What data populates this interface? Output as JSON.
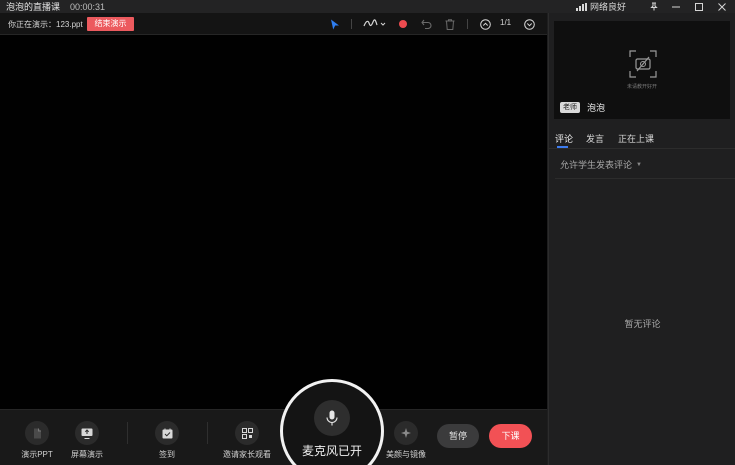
{
  "window": {
    "title": "泡泡的直播课",
    "timer": "00:00:31",
    "network_label": "网络良好"
  },
  "presentation": {
    "status_text": "你正在演示：123.ppt",
    "end_label": "结束演示",
    "page_indicator": "1/1",
    "tools": [
      "pointer-icon",
      "pen-icon",
      "color-dot-icon",
      "undo-icon",
      "trash-icon",
      "page-up-icon",
      "page-down-icon"
    ],
    "accent_color": "#ec5a5e"
  },
  "bottom": {
    "ppt_label": "演示PPT",
    "screen_label": "屏幕演示",
    "checkin_label": "签到",
    "invite_label": "邀请家长观看",
    "mic_label": "麦克风已开",
    "beauty_label": "美颜与镜像",
    "pause_label": "暂停",
    "end_class_label": "下课"
  },
  "panel": {
    "camera_caption": "未请教开好开",
    "role_badge": "老师",
    "teacher_name": "泡泡",
    "tabs": [
      "评论",
      "发言",
      "正在上课"
    ],
    "allow_comments": "允许学生发表评论",
    "empty_text": "暂无评论"
  }
}
